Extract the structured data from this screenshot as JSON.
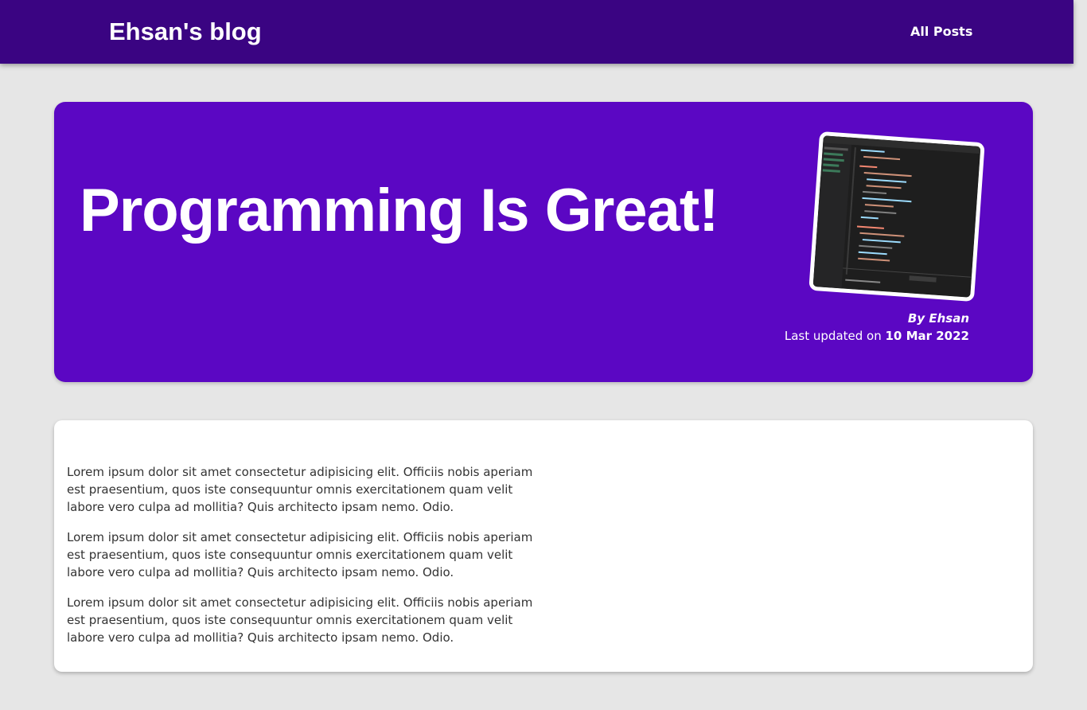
{
  "nav": {
    "brand": "Ehsan's blog",
    "links": [
      {
        "label": "All Posts"
      }
    ]
  },
  "hero": {
    "title": "Programming Is Great!",
    "image_icon": "code-editor-screenshot",
    "author": "By Ehsan",
    "updated_prefix": "Last updated on ",
    "updated_date": "10 Mar 2022"
  },
  "content": {
    "paragraphs": [
      "Lorem ipsum dolor sit amet consectetur adipisicing elit. Officiis nobis aperiam est praesentium, quos iste consequuntur omnis exercitationem quam velit labore vero culpa ad mollitia? Quis architecto ipsam nemo. Odio.",
      "Lorem ipsum dolor sit amet consectetur adipisicing elit. Officiis nobis aperiam est praesentium, quos iste consequuntur omnis exercitationem quam velit labore vero culpa ad mollitia? Quis architecto ipsam nemo. Odio.",
      "Lorem ipsum dolor sit amet consectetur adipisicing elit. Officiis nobis aperiam est praesentium, quos iste consequuntur omnis exercitationem quam velit labore vero culpa ad mollitia? Quis architecto ipsam nemo. Odio."
    ]
  },
  "colors": {
    "nav_bg": "#3a0482",
    "hero_bg": "#5b07c3",
    "page_bg": "#e6e6e6",
    "card_bg": "#ffffff"
  }
}
